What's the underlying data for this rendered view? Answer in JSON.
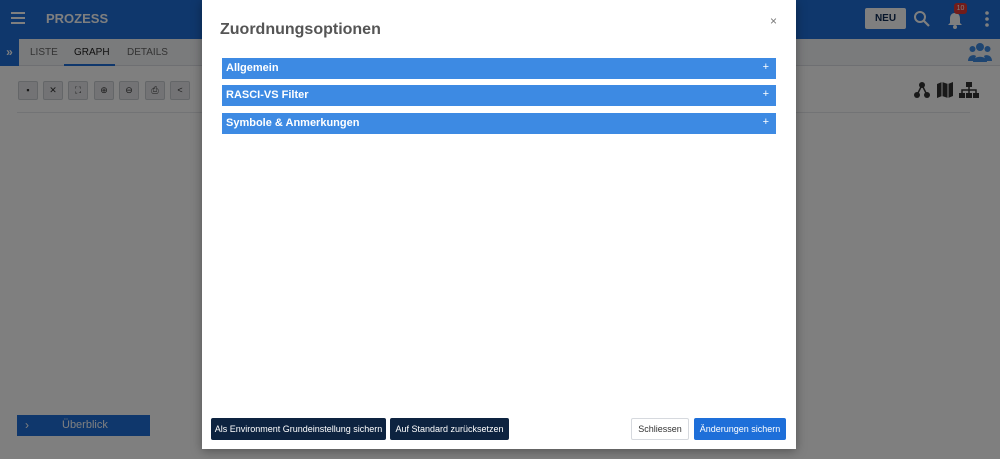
{
  "app": {
    "title": "PROZESS",
    "new_button": "NEU",
    "notification_count": "10",
    "expand_label": "»",
    "tabs": [
      {
        "label": "LISTE",
        "active": false
      },
      {
        "label": "GRAPH",
        "active": true
      },
      {
        "label": "DETAILS",
        "active": false
      }
    ],
    "toolbar_icons": [
      "document-icon",
      "fit-icon",
      "fullscreen-icon",
      "zoom-in-icon",
      "zoom-out-icon",
      "print-icon",
      "share-icon"
    ],
    "graph_view_icons": [
      "network-icon",
      "map-icon",
      "hierarchy-icon"
    ],
    "overview_button": "Überblick",
    "accent_color": "#1e6fd9"
  },
  "modal": {
    "title": "Zuordnungsoptionen",
    "close_label": "×",
    "sections": [
      {
        "label": "Allgemein",
        "toggle": "+"
      },
      {
        "label": "RASCI-VS Filter",
        "toggle": "+"
      },
      {
        "label": "Symbole & Anmerkungen",
        "toggle": "+"
      }
    ],
    "footer": {
      "save_env_default": "Als Environment Grundeinstellung sichern",
      "reset_default": "Auf Standard zurücksetzen",
      "close": "Schliessen",
      "save_changes": "Änderungen sichern"
    }
  }
}
